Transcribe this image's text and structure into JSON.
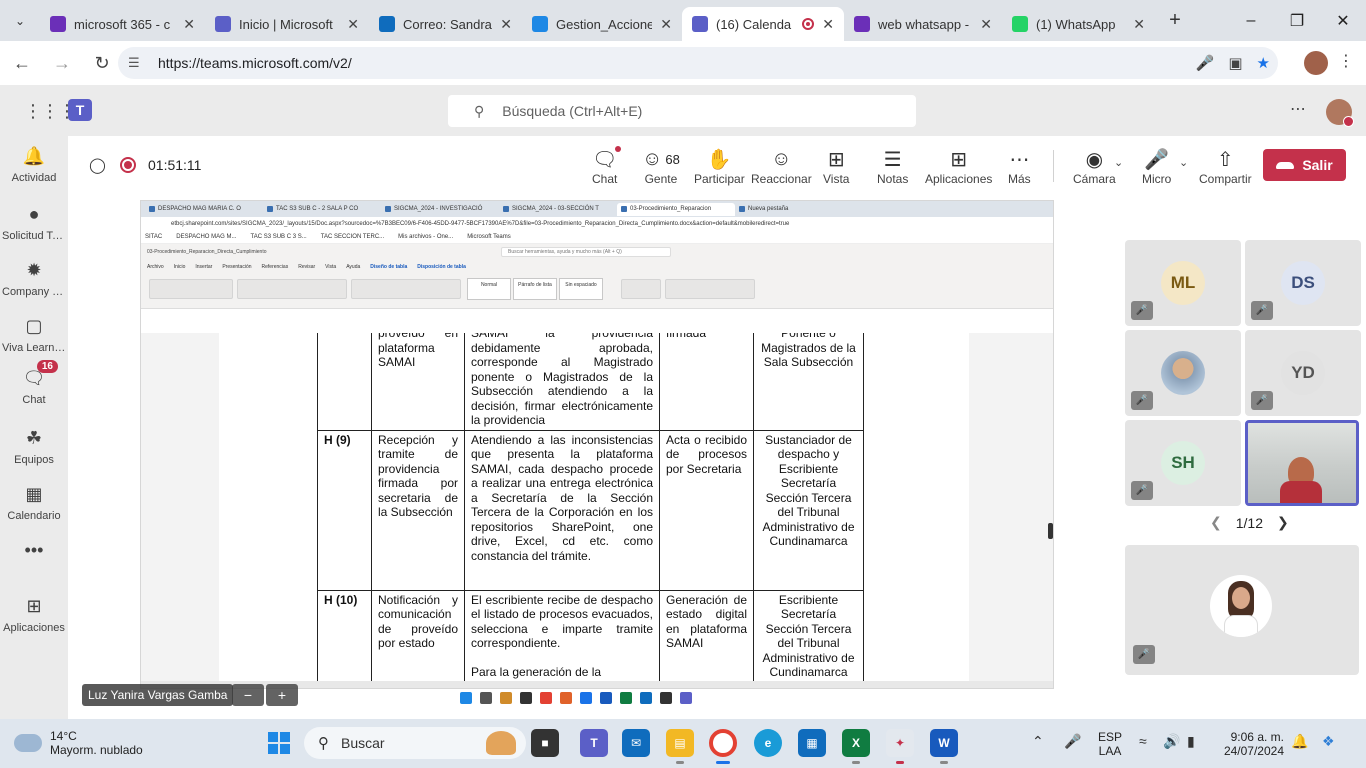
{
  "browser": {
    "tabs": [
      {
        "title": "microsoft 365 - c",
        "color": "#6b2fb8",
        "active": false
      },
      {
        "title": "Inicio | Microsoft",
        "color": "#5b5fc7",
        "active": false
      },
      {
        "title": "Correo: Sandra P",
        "color": "#0f6cbd",
        "active": false
      },
      {
        "title": "Gestion_Accione",
        "color": "#1e88e5",
        "active": false
      },
      {
        "title": "(16) Calenda",
        "color": "#5b5fc7",
        "active": true
      },
      {
        "title": "web whatsapp -",
        "color": "#6b2fb8",
        "active": false
      },
      {
        "title": "(1) WhatsApp",
        "color": "#25d366",
        "active": false
      }
    ],
    "url": "https://teams.microsoft.com/v2/"
  },
  "teams": {
    "search_placeholder": "Búsqueda (Ctrl+Alt+E)"
  },
  "rail": [
    {
      "label": "Actividad",
      "icon": "bell-icon"
    },
    {
      "label": "Solicitud Tel...",
      "icon": "app-icon"
    },
    {
      "label": "Company C...",
      "icon": "company-icon"
    },
    {
      "label": "Viva Learning",
      "icon": "learning-icon"
    },
    {
      "label": "Chat",
      "icon": "chat-icon",
      "badge": "16"
    },
    {
      "label": "Equipos",
      "icon": "teams-icon"
    },
    {
      "label": "Calendario",
      "icon": "calendar-icon"
    },
    {
      "label": "...",
      "icon": "more-icon"
    },
    {
      "label": "Aplicaciones",
      "icon": "apps-icon"
    }
  ],
  "meeting": {
    "timer": "01:51:11",
    "controls": {
      "chat": "Chat",
      "people": "Gente",
      "people_count": "68",
      "raise": "Participar",
      "react": "Reaccionar",
      "view": "Vista",
      "notes": "Notas",
      "apps": "Aplicaciones",
      "more": "Más",
      "camera": "Cámara",
      "mic": "Micro",
      "share": "Compartir",
      "leave": "Salir"
    },
    "presenter": "Luz Yanira Vargas Gamba",
    "pager": "1/12",
    "participants": [
      {
        "initials": "ML",
        "bg": "#f4e7c6",
        "fg": "#7a5a12"
      },
      {
        "initials": "DS",
        "bg": "#dfe5f2",
        "fg": "#3c4f7c"
      },
      {
        "initials": "",
        "bg": "#c9a27b",
        "fg": "#333"
      },
      {
        "initials": "YD",
        "bg": "#e2e2e2",
        "fg": "#555"
      },
      {
        "initials": "SH",
        "bg": "#dcefe2",
        "fg": "#2f6b3f"
      }
    ]
  },
  "shared": {
    "tabs": [
      "DESPACHO MAG MARIA C. O",
      "TAC S3 SUB C - 2 SALA P CO",
      "SIGCMA_2024 - INVESTIGACIÓ",
      "SIGCMA_2024 - 03-SECCIÓN T",
      "03-Procedimiento_Reparacion",
      "Nueva pestaña"
    ],
    "url": "etbcj.sharepoint.com/sites/SIGCMA_2023/_layouts/15/Doc.aspx?sourcedoc=%7B3BEC09/6-F406-45DD-9477-5BCF17390AE%7D&file=03-Procedimiento_Reparacion_Directa_Cumplimiento.docx&action=default&mobileredirect=true",
    "bookmarks": [
      "SITAC",
      "DESPACHO MAG M...",
      "TAC S3 SUB C 3 S...",
      "TAC SECCION TERC...",
      "Mis archivos - One...",
      "Microsoft Teams"
    ],
    "word_title": "03-Procedimiento_Reparacion_Directa_Cumplimiento",
    "word_search": "Buscar herramientas, ayuda y mucho más (Alt + Q)",
    "menu": [
      "Archivo",
      "Inicio",
      "Insertar",
      "Presentación",
      "Referencias",
      "Revisar",
      "Vista",
      "Ayuda",
      "Diseño de tabla",
      "Disposición de tabla"
    ],
    "styles": [
      "Normal",
      "Párrafo de lista",
      "Sin espaciado"
    ],
    "table": [
      {
        "id": "",
        "step": "proveído en plataforma SAMAI",
        "desc": "SAMAI la providencia debidamente aprobada, corresponde al Magistrado ponente o Magistrados de la Subsección atendiendo a la decisión, firmar electrónicamente la providencia",
        "output": "firmada",
        "resp": "Ponente o Magistrados de la Sala Subsección"
      },
      {
        "id": "H (9)",
        "step": "Recepción y tramite de providencia firmada por secretaria de la Subsección",
        "desc": "Atendiendo a las inconsistencias que presenta la plataforma SAMAI, cada despacho procede a realizar una entrega electrónica a Secretaría de la Sección Tercera de la Corporación en los repositorios SharePoint, one drive, Excel, cd etc. como constancia del trámite.",
        "output": "Acta o recibido de procesos por Secretaria",
        "resp": "Sustanciador de despacho y Escribiente Secretaría Sección Tercera del Tribunal Administrativo de Cundinamarca"
      },
      {
        "id": "H (10)",
        "step": "Notificación y comunicación de proveído por estado",
        "desc": "El escribiente recibe de despacho el listado de procesos evacuados, selecciona e imparte tramite correspondiente.",
        "desc2": "Para la generación de la",
        "output": "Generación de estado digital en plataforma SAMAI",
        "resp": "Escribiente Secretaría Sección Tercera del Tribunal Administrativo de Cundinamarca"
      }
    ]
  },
  "taskbar": {
    "weather_temp": "14°C",
    "weather_desc": "Mayorm. nublado",
    "search": "Buscar",
    "lang1": "ESP",
    "lang2": "LAA",
    "time": "9:06 a. m.",
    "date": "24/07/2024"
  }
}
